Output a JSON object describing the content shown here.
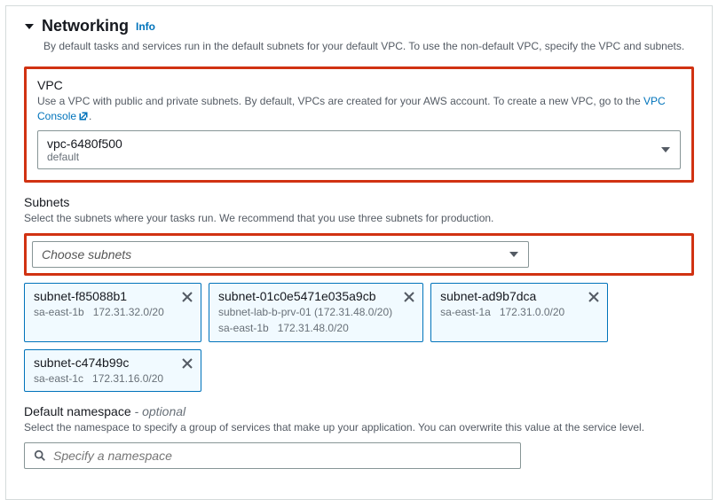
{
  "header": {
    "title": "Networking",
    "info": "Info",
    "description": "By default tasks and services run in the default subnets for your default VPC. To use the non-default VPC, specify the VPC and subnets."
  },
  "vpc": {
    "label": "VPC",
    "hint_pre": "Use a VPC with public and private subnets. By default, VPCs are created for your AWS account. To create a new VPC, go to the ",
    "link_text": "VPC Console",
    "hint_post": ".",
    "selected_value": "vpc-6480f500",
    "selected_sub": "default"
  },
  "subnets": {
    "label": "Subnets",
    "hint": "Select the subnets where your tasks run. We recommend that you use three subnets for production.",
    "placeholder": "Choose subnets",
    "items": [
      {
        "id": "subnet-f85088b1",
        "line1_left": "sa-east-1b",
        "line1_right": "172.31.32.0/20",
        "line2_left": "",
        "line2_right": ""
      },
      {
        "id": "subnet-01c0e5471e035a9cb",
        "line1_left": "subnet-lab-b-prv-01 (172.31.48.0/20)",
        "line1_right": "",
        "line2_left": "sa-east-1b",
        "line2_right": "172.31.48.0/20"
      },
      {
        "id": "subnet-ad9b7dca",
        "line1_left": "sa-east-1a",
        "line1_right": "172.31.0.0/20",
        "line2_left": "",
        "line2_right": ""
      },
      {
        "id": "subnet-c474b99c",
        "line1_left": "sa-east-1c",
        "line1_right": "172.31.16.0/20",
        "line2_left": "",
        "line2_right": ""
      }
    ]
  },
  "namespace": {
    "label_main": "Default namespace",
    "label_optional": " - optional",
    "hint": "Select the namespace to specify a group of services that make up your application. You can overwrite this value at the service level.",
    "placeholder": "Specify a namespace"
  }
}
